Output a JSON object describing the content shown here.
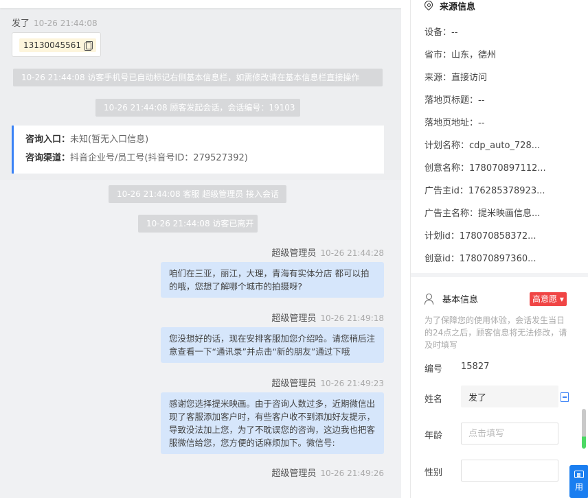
{
  "chat": {
    "first": {
      "sender": "发了",
      "time": "10-26 21:44:08",
      "phone": "13130045561"
    },
    "sys1": "10-26 21:44:08 访客手机号已自动标记右侧基本信息栏，如需修改请在基本信息栏直接操作",
    "sys2": "10-26 21:44:08 顾客发起会话，会话编号：19103",
    "entry": {
      "k1": "咨询入口：",
      "v1": "未知(暂无入口信息)",
      "k2": "咨询渠道：",
      "v2": "抖音企业号/员工号(抖音号ID：279527392)"
    },
    "sys3": "10-26 21:44:08 客服 超级管理员 接入会话",
    "sys4": "10-26 21:44:08 访客已离开",
    "messages": [
      {
        "sender": "超级管理员",
        "time": "10-26 21:44:28",
        "text": "咱们在三亚，丽江，大理，青海有实体分店 都可以拍的哦，您想了解哪个城市的拍摄呀?"
      },
      {
        "sender": "超级管理员",
        "time": "10-26 21:49:18",
        "text": "您没想好的话，现在安排客服加您介绍哈。请您稍后注意查看一下“通讯录”并点击“新的朋友”通过下哦"
      },
      {
        "sender": "超级管理员",
        "time": "10-26 21:49:23",
        "text": "感谢您选择提米映画。由于咨询人数过多，近期微信出现了客服添加客户时，有些客户收不到添加好友提示，导致没法加上您，为了不耽误您的咨询，这边我也把客服微信给您，您方便的话麻烦加下。微信号:"
      },
      {
        "sender": "超级管理员",
        "time": "10-26 21:49:26",
        "text": ""
      }
    ]
  },
  "source": {
    "title": "来源信息",
    "items": [
      "设备：--",
      "省市：山东，德州",
      "来源：直接访问",
      "落地页标题：--",
      "落地页地址：--",
      "计划名称：cdp_auto_728...",
      "创意名称：178070897112...",
      "广告主id：176285378923...",
      "广告主名称：提米映画信息...",
      "计划id：178070858372...",
      "创意id：178070897360..."
    ]
  },
  "basic": {
    "title": "基本信息",
    "badge": "高意愿 ▾",
    "notice": "为了保障您的使用体验，会话发生当日的24点之后，顾客信息将无法修改，请及时填写",
    "id_label": "编号",
    "id_value": "15827",
    "name_label": "姓名",
    "name_value": "发了",
    "age_label": "年龄",
    "age_placeholder": "点击填写",
    "gender_label": "性别",
    "float_btn": "用"
  },
  "colors": {
    "accent": "#3b82f6",
    "badge": "#f04545",
    "bubble": "#d6e6fb"
  }
}
